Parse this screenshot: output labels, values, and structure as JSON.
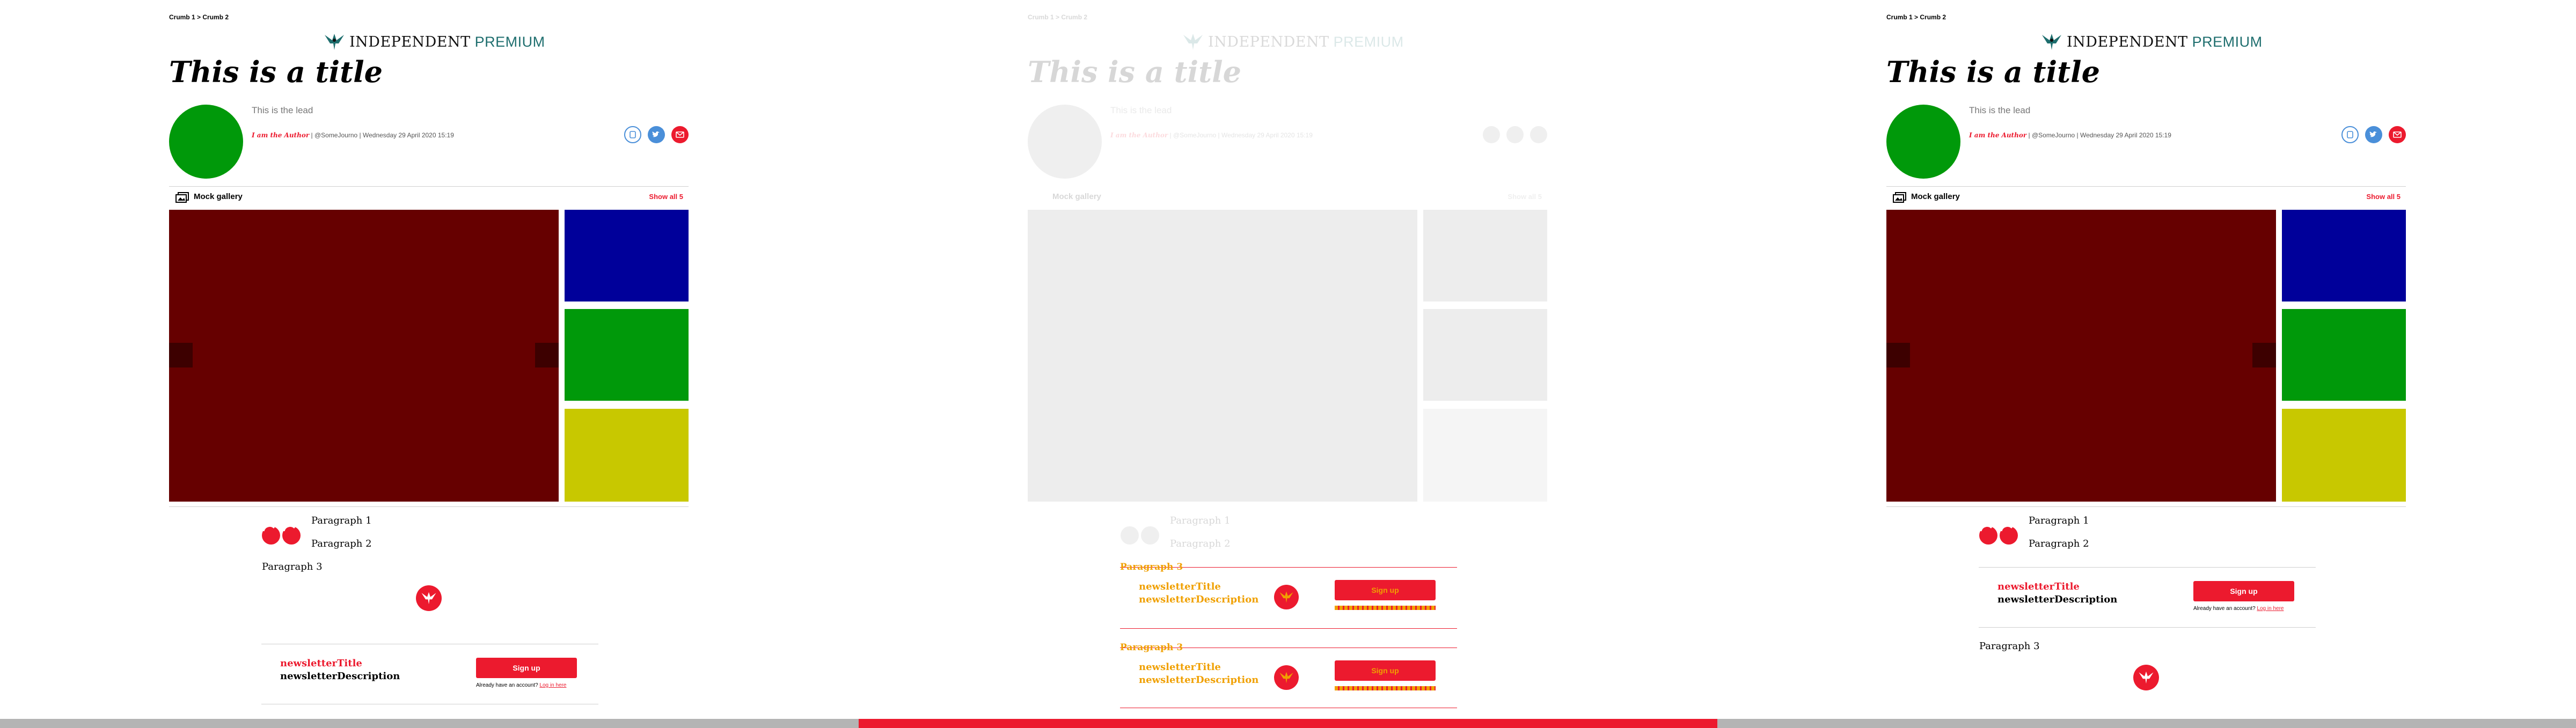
{
  "breadcrumb": {
    "items": [
      "Crumb 1",
      "Crumb 2"
    ],
    "separator": ">"
  },
  "brand": {
    "word1": "INDEPENDENT",
    "word2": "PREMIUM",
    "color_main": "#111111",
    "color_accent": "#1e6e6e"
  },
  "article": {
    "title": "This is a title",
    "lead": "This is the lead",
    "author": "I am the Author",
    "handle": "@SomeJourno",
    "date": "Wednesday 29 April 2020 15:19",
    "avatar_color": "#00990a",
    "share_icons": [
      "bookmark-icon",
      "twitter-icon",
      "email-icon"
    ]
  },
  "gallery": {
    "title": "Mock gallery",
    "show_all": "Show all 5",
    "main_color": "#660000",
    "thumb_colors": [
      "#00009a",
      "#00990a",
      "#c8c800"
    ]
  },
  "body": {
    "p1": "Paragraph 1",
    "p2": "Paragraph 2",
    "p3": "Paragraph 3",
    "quote_icon": "quote-icon",
    "badge_icon": "eagle-icon"
  },
  "newsletter": {
    "title": "newsletterTitle",
    "description": "newsletterDescription",
    "signup": "Sign up",
    "account_text": "Already have an account?",
    "login_link": "Log in here"
  },
  "colors": {
    "accent": "#ec1a2e",
    "overlay": "#f0a000",
    "progress_track": "#b4b4b4"
  },
  "progress": {
    "filled_fraction": 0.333
  }
}
